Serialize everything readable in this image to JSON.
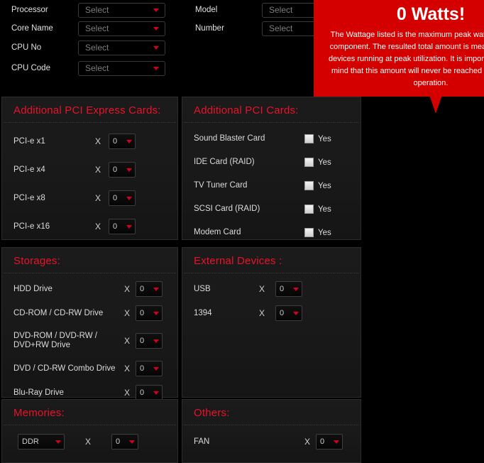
{
  "cpu_form": {
    "fields": [
      {
        "label": "Processor",
        "value": "Select"
      },
      {
        "label": "Core Name",
        "value": "Select"
      },
      {
        "label": "CPU No",
        "value": "Select"
      },
      {
        "label": "CPU Code",
        "value": "Select"
      }
    ]
  },
  "video_form": {
    "fields": [
      {
        "label": "Model",
        "value": "Select"
      },
      {
        "label": "Number",
        "value": "Select"
      }
    ]
  },
  "tooltip": {
    "title": "0 Watts!",
    "body": "The Wattage listed is the maximum peak wattage for each component. The resulted total amount is measured with all devices running at peak utilization. It is important to keep in mind that this amount will never be reached under normal operation.",
    "background_color": "#d40000",
    "text_color": "#ffffff"
  },
  "pci_express": {
    "title": "Additional PCI Express Cards:",
    "multiplier": "X",
    "rows": [
      {
        "label": "PCI-e x1",
        "qty": "0"
      },
      {
        "label": "PCI-e x4",
        "qty": "0"
      },
      {
        "label": "PCI-e x8",
        "qty": "0"
      },
      {
        "label": "PCI-e x16",
        "qty": "0"
      }
    ]
  },
  "pci_cards": {
    "title": "Additional PCI Cards:",
    "yes_label": "Yes",
    "rows": [
      {
        "label": "Sound Blaster Card",
        "checked": false
      },
      {
        "label": "IDE Card (RAID)",
        "checked": false
      },
      {
        "label": "TV Tuner Card",
        "checked": false
      },
      {
        "label": "SCSI Card (RAID)",
        "checked": false
      },
      {
        "label": "Modem Card",
        "checked": false
      }
    ]
  },
  "storages": {
    "title": "Storages:",
    "multiplier": "X",
    "rows": [
      {
        "label": "HDD Drive",
        "qty": "0"
      },
      {
        "label": "CD-ROM / CD-RW Drive",
        "qty": "0"
      },
      {
        "label": "DVD-ROM / DVD-RW / DVD+RW Drive",
        "qty": "0"
      },
      {
        "label": "DVD / CD-RW Combo Drive",
        "qty": "0"
      },
      {
        "label": "Blu-Ray Drive",
        "qty": "0"
      }
    ]
  },
  "external_devices": {
    "title": "External Devices :",
    "multiplier": "X",
    "rows": [
      {
        "label": "USB",
        "qty": "0"
      },
      {
        "label": "1394",
        "qty": "0"
      }
    ]
  },
  "memories": {
    "title": "Memories:",
    "multiplier": "X",
    "rows": [
      {
        "type": "DDR",
        "qty": "0"
      }
    ]
  },
  "others": {
    "title": "Others:",
    "multiplier": "X",
    "rows": [
      {
        "label": "FAN",
        "qty": "0"
      }
    ]
  },
  "colors": {
    "accent_red": "#e8132a",
    "caret_red": "#d2001a",
    "panel_bg": "#191919",
    "page_bg": "#000000"
  }
}
